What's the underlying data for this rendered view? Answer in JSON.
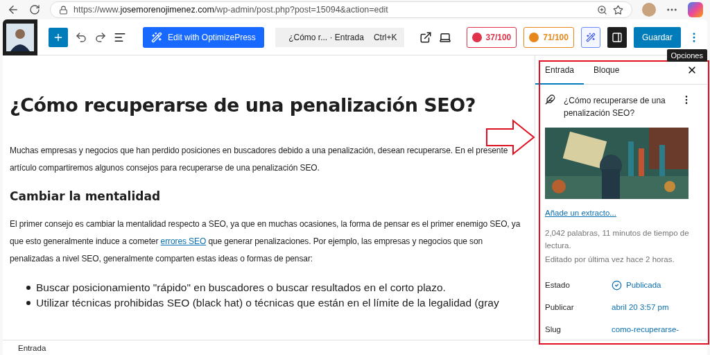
{
  "browser": {
    "url_prefix": "https://www.",
    "url_domain": "josemorenojimenez.com",
    "url_path": "/wp-admin/post.php?post=15094&action=edit"
  },
  "toolbar": {
    "optimize_button": "Edit with OptimizePress",
    "command": {
      "title": "¿Cómo r...",
      "type": "· Entrada",
      "shortcut": "Ctrl+K"
    },
    "scores": [
      {
        "label": "37/100",
        "color": "#e0324a"
      },
      {
        "label": "71/100",
        "color": "#e7881a"
      }
    ],
    "sidebar_toggle": {
      "on": true
    },
    "save_button": "Guardar",
    "tooltip": "Opciones"
  },
  "editor": {
    "title": "¿Cómo recuperarse de una penalización SEO?",
    "blocks": [
      {
        "kind": "paragraph",
        "text": "Muchas empresas y negocios que han perdido posiciones en buscadores debido a una penalización, desean recuperarse. En el presente artículo compartiremos algunos consejos para recuperarse de una penalización SEO."
      },
      {
        "kind": "heading",
        "text": "Cambiar la mentalidad"
      },
      {
        "kind": "paragraph",
        "text": "El primer consejo es cambiar la mentalidad respecto a SEO, ya que en muchas ocasiones, la forma de pensar es el primer enemigo SEO, ya que esto generalmente induce a cometer ",
        "link": "errores SEO",
        "after": " que generar penalizaciones. Por ejemplo, las empresas y negocios que son penalizadas a nivel SEO, generalmente comparten estas ideas o formas de pensar:"
      },
      {
        "kind": "list",
        "items": [
          "Buscar posicionamiento \"rápido\" en buscadores o buscar resultados en el corto plazo.",
          "Utilizar técnicas prohibidas SEO (black hat) o técnicas que están en el límite de la legalidad (gray"
        ]
      }
    ]
  },
  "sidebar": {
    "tabs": [
      {
        "label": "Entrada",
        "selected": true
      },
      {
        "label": "Bloque",
        "selected": false
      }
    ],
    "post_title": "¿Cómo recuperarse de una penalización SEO?",
    "excerpt_link": "Añade un extracto...",
    "stats": "2,042 palabras, 11 minutos de tiempo de lectura.",
    "edited": "Editado por última vez hace 2 horas.",
    "fields": [
      {
        "label": "Estado",
        "value": "Publicada",
        "kind": "status"
      },
      {
        "label": "Publicar",
        "value": "abril 20 3:57 pm",
        "kind": "link"
      },
      {
        "label": "Slug",
        "value": "como-recuperarse-",
        "kind": "link"
      }
    ]
  },
  "footer": {
    "breadcrumb": "Entrada"
  }
}
